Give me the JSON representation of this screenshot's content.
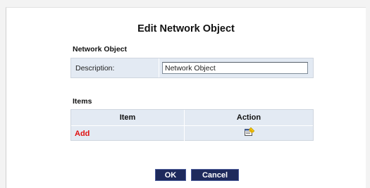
{
  "page": {
    "title": "Edit Network Object"
  },
  "network_object": {
    "section_title": "Network Object",
    "description_label": "Description:",
    "description_value": "Network Object"
  },
  "items": {
    "section_title": "Items",
    "columns": [
      "Item",
      "Action"
    ],
    "add_label": "Add",
    "add_icon": "add-edit-icon"
  },
  "buttons": {
    "ok_label": "OK",
    "cancel_label": "Cancel"
  },
  "colors": {
    "row_background": "#e3eaf3",
    "add_link": "#e01010",
    "button_background": "#1e2a5c"
  }
}
